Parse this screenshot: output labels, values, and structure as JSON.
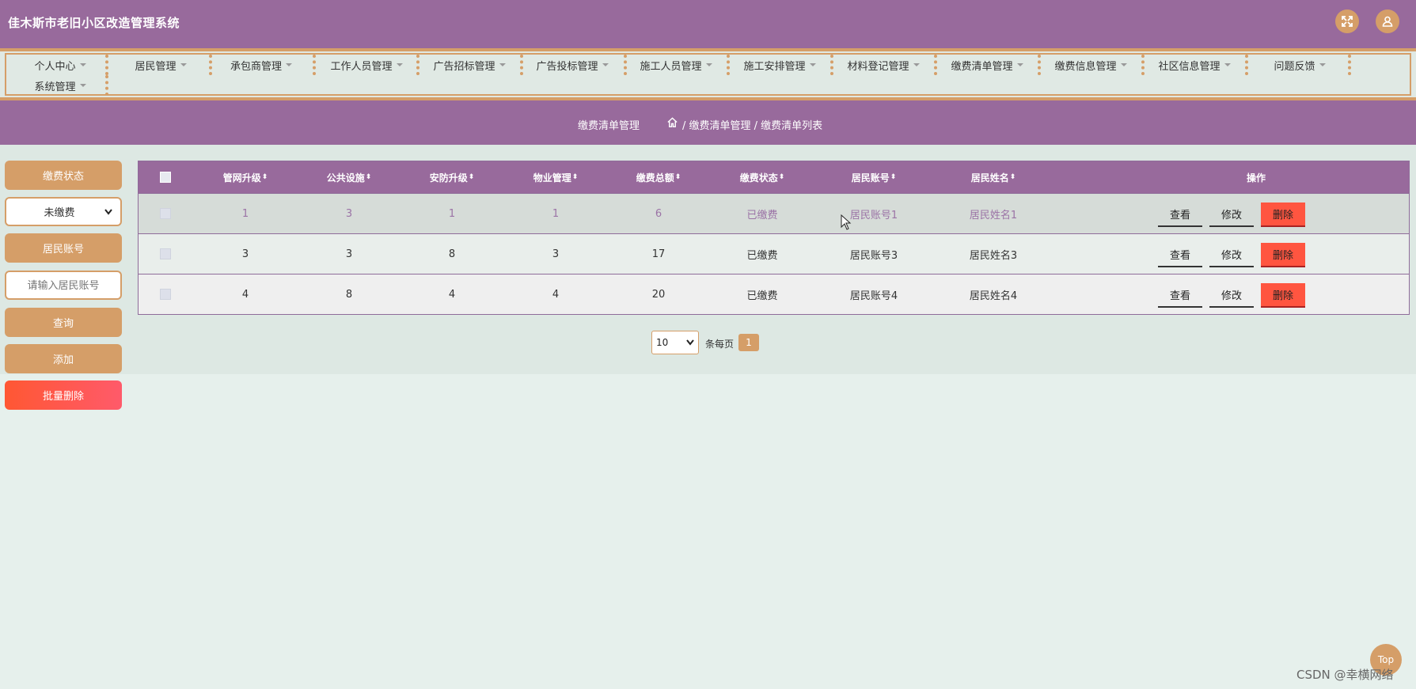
{
  "app": {
    "title": "佳木斯市老旧小区改造管理系统"
  },
  "header": {
    "fullscreen_icon": "fullscreen-icon",
    "user_icon": "user-icon"
  },
  "nav": {
    "items": [
      {
        "label": "个人中心"
      },
      {
        "label": "居民管理"
      },
      {
        "label": "承包商管理"
      },
      {
        "label": "工作人员管理"
      },
      {
        "label": "广告招标管理"
      },
      {
        "label": "广告投标管理"
      },
      {
        "label": "施工人员管理"
      },
      {
        "label": "施工安排管理"
      },
      {
        "label": "材料登记管理"
      },
      {
        "label": "缴费清单管理"
      },
      {
        "label": "缴费信息管理"
      },
      {
        "label": "社区信息管理"
      },
      {
        "label": "问题反馈"
      },
      {
        "label": "系统管理"
      }
    ]
  },
  "breadcrumb": {
    "title": "缴费清单管理",
    "path": "/ 缴费清单管理 / 缴费清单列表"
  },
  "search": {
    "status_label": "缴费状态",
    "status_selected": "未缴费",
    "account_label": "居民账号",
    "account_placeholder": "请输入居民账号",
    "query_button": "查询",
    "add_button": "添加",
    "batch_delete_button": "批量删除"
  },
  "table": {
    "columns": [
      "管网升级",
      "公共设施",
      "安防升级",
      "物业管理",
      "缴费总额",
      "缴费状态",
      "居民账号",
      "居民姓名"
    ],
    "action_header": "操作",
    "rows": [
      {
        "c0": "1",
        "c1": "3",
        "c2": "1",
        "c3": "1",
        "c4": "6",
        "c5": "已缴费",
        "c6": "居民账号1",
        "c7": "居民姓名1"
      },
      {
        "c0": "3",
        "c1": "3",
        "c2": "8",
        "c3": "3",
        "c4": "17",
        "c5": "已缴费",
        "c6": "居民账号3",
        "c7": "居民姓名3"
      },
      {
        "c0": "4",
        "c1": "8",
        "c2": "4",
        "c3": "4",
        "c4": "20",
        "c5": "已缴费",
        "c6": "居民账号4",
        "c7": "居民姓名4"
      }
    ],
    "actions": {
      "view": "查看",
      "edit": "修改",
      "delete": "删除"
    }
  },
  "pagination": {
    "page_size": "10",
    "per_page_label": "条每页",
    "current_page": "1"
  },
  "top_button": "Top",
  "watermark": "CSDN @幸横网络",
  "colors": {
    "primary": "#986a9c",
    "accent": "#d59e68",
    "danger": "#ff5540",
    "background": "#e6f0ec"
  }
}
